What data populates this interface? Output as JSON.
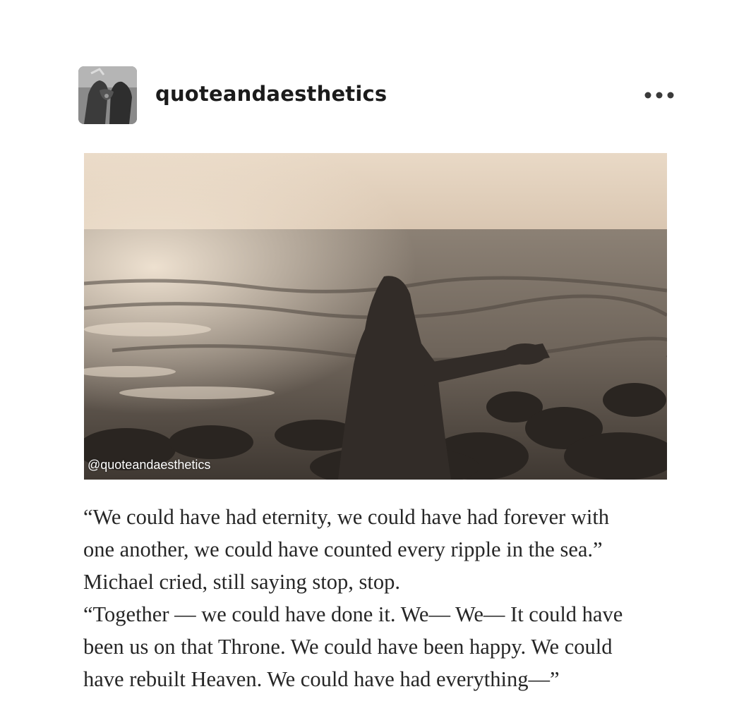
{
  "post": {
    "blog_name": "quoteandaesthetics",
    "avatar_icon": "avatar-hands-photo",
    "more_icon": "ellipsis-icon",
    "image": {
      "description_icon": "photo-woman-on-rocky-shore",
      "watermark": "@quoteandaesthetics"
    },
    "quote_lines": [
      "“We could have had eternity, we could have had forever with",
      "one another, we could have counted every ripple in the sea.”",
      "Michael cried, still saying stop, stop.",
      "“Together — we could have done it. We— We— It could have",
      "been us on that Throne. We could have been happy. We could",
      "have rebuilt Heaven. We could have had everything—”"
    ]
  },
  "colors": {
    "background": "#ffffff",
    "text": "#262626",
    "sepia_light": "#e8d8c4",
    "sepia_dark": "#3a3430"
  }
}
